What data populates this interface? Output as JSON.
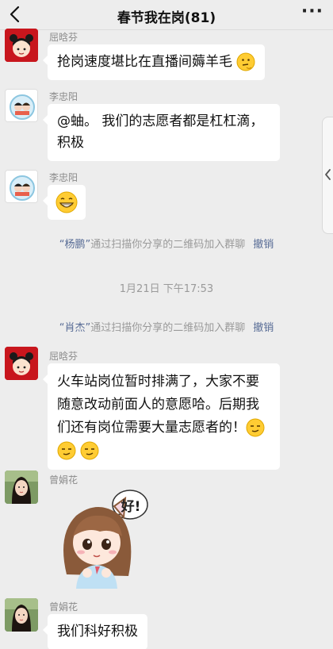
{
  "header": {
    "title": "春节我在岗(81)",
    "more": "···"
  },
  "messages": [
    {
      "sender": "屈晗芬",
      "text": "抢岗速度堪比在直播间薅羊毛"
    },
    {
      "sender": "李忠阳",
      "line1": "@蚰。 我们的志愿者都是杠杠滴，",
      "line2": "积极"
    },
    {
      "sender": "李忠阳"
    },
    {
      "sender": "屈晗芬",
      "line1": "火车站岗位暂时排满了，大家不要",
      "line2": "随意改动前面人的意愿哈。后期我",
      "line3": "们还有岗位需要大量志愿者的！"
    },
    {
      "sender": "曾娟花",
      "sticker_text": "好!"
    },
    {
      "sender": "曾娟花",
      "text": "我们科好积极"
    }
  ],
  "system": {
    "join1_name": "“杨鹏”",
    "join1_text": "通过扫描你分享的二维码加入群聊",
    "timestamp": "1月21日 下午17:53",
    "join2_name": "“肖杰”",
    "join2_text": "通过扫描你分享的二维码加入群聊",
    "undo": "撤销"
  },
  "colors": {
    "background": "#ededed",
    "bubble": "#ffffff",
    "link": "#576b95",
    "meta": "#9a9a9a"
  }
}
